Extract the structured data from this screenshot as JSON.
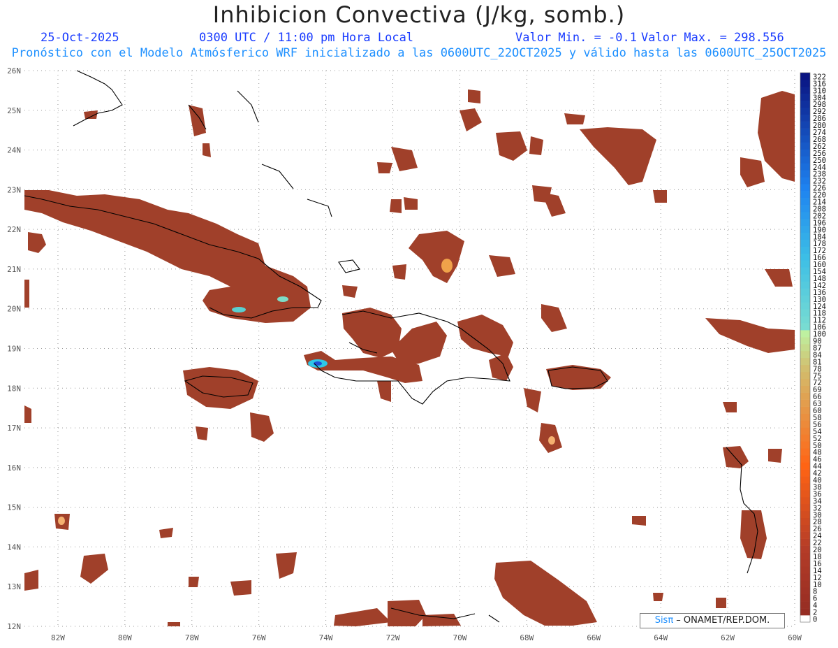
{
  "header": {
    "title": "Inhibicion Convectiva (J/kg, somb.)",
    "date": "25-Oct-2025",
    "time": "0300 UTC / 11:00 pm Hora Local",
    "vmin": "Valor Min. = -0.1",
    "vmax": "Valor Max. = 298.556",
    "subtitle": "Pronóstico con el Modelo Atmósferico WRF inicializado a las 0600UTC_22OCT2025 y válido hasta las  0600UTC_25OCT2025"
  },
  "map": {
    "lon_range": [
      -83,
      -60
    ],
    "lat_range": [
      12,
      26
    ],
    "lon_labels": [
      "82W",
      "80W",
      "78W",
      "76W",
      "74W",
      "72W",
      "70W",
      "68W",
      "66W",
      "64W",
      "62W",
      "60W"
    ],
    "lat_labels": [
      "12N",
      "13N",
      "14N",
      "15N",
      "16N",
      "17N",
      "18N",
      "19N",
      "20N",
      "21N",
      "22N",
      "23N",
      "24N",
      "25N",
      "26N"
    ],
    "grid": true,
    "field_color": "#a0402a",
    "coast_color": "#000000"
  },
  "colorbar": {
    "labels": [
      "0",
      "2",
      "4",
      "6",
      "8",
      "10",
      "12",
      "14",
      "16",
      "18",
      "20",
      "22",
      "24",
      "26",
      "28",
      "30",
      "32",
      "34",
      "36",
      "38",
      "40",
      "42",
      "44",
      "46",
      "48",
      "50",
      "52",
      "54",
      "56",
      "58",
      "60",
      "63",
      "66",
      "69",
      "72",
      "75",
      "78",
      "81",
      "84",
      "87",
      "90",
      "100",
      "106",
      "112",
      "118",
      "124",
      "130",
      "136",
      "142",
      "148",
      "154",
      "160",
      "166",
      "172",
      "178",
      "184",
      "190",
      "196",
      "202",
      "208",
      "214",
      "220",
      "226",
      "232",
      "238",
      "244",
      "250",
      "256",
      "262",
      "268",
      "274",
      "280",
      "286",
      "292",
      "298",
      "304",
      "310",
      "316",
      "322"
    ]
  },
  "credit": {
    "brand": "Sisπ",
    "text": " – ONAMET/REP.DOM."
  }
}
